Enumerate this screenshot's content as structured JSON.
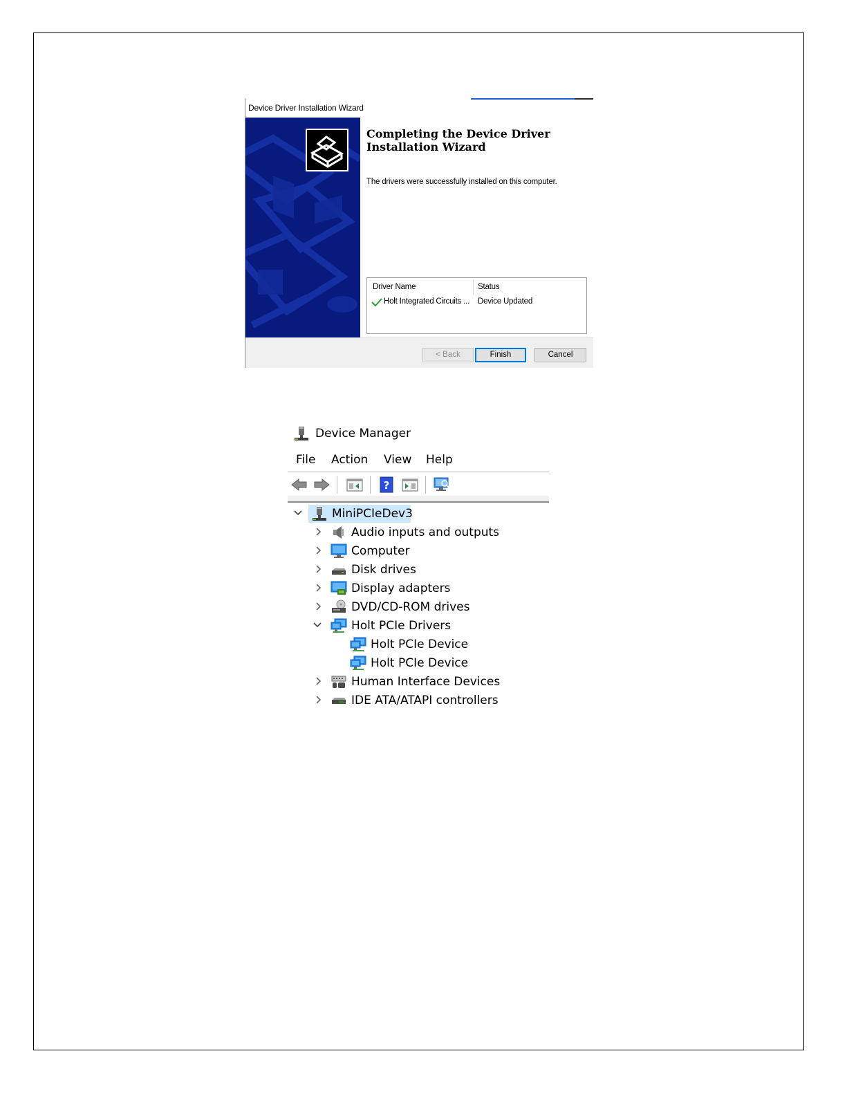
{
  "wizard": {
    "window_title": "Device Driver Installation Wizard",
    "heading_line1": "Completing the Device Driver",
    "heading_line2": "Installation Wizard",
    "message": "The drivers were successfully installed on this computer.",
    "table": {
      "columns": [
        "Driver Name",
        "Status"
      ],
      "rows": [
        {
          "name": "Holt Integrated Circuits ...",
          "status": "Device Updated",
          "icon": "check-icon"
        }
      ]
    },
    "buttons": {
      "back": "< Back",
      "finish": "Finish",
      "cancel": "Cancel"
    },
    "colors": {
      "banner": "#0a1e8c",
      "banner_dark": "#050f55",
      "check": "#2e9a3a"
    }
  },
  "device_manager": {
    "title": "Device Manager",
    "menu": [
      "File",
      "Action",
      "View",
      "Help"
    ],
    "toolbar": [
      "back-arrow-icon",
      "forward-arrow-icon",
      "properties-icon",
      "help-icon",
      "update-driver-icon",
      "scan-hardware-icon"
    ],
    "tree": {
      "root": "MiniPCIeDev3",
      "categories": [
        {
          "label": "Audio inputs and outputs",
          "icon": "speaker-icon",
          "expanded": false
        },
        {
          "label": "Computer",
          "icon": "monitor-icon",
          "expanded": false
        },
        {
          "label": "Disk drives",
          "icon": "disk-drive-icon",
          "expanded": false
        },
        {
          "label": "Display adapters",
          "icon": "display-adapter-icon",
          "expanded": false
        },
        {
          "label": "DVD/CD-ROM drives",
          "icon": "dvd-drive-icon",
          "expanded": false
        },
        {
          "label": "Holt PCIe Drivers",
          "icon": "network-adapter-icon",
          "expanded": true,
          "children": [
            "Holt PCIe Device",
            "Holt PCIe Device"
          ]
        },
        {
          "label": "Human Interface Devices",
          "icon": "hid-icon",
          "expanded": false
        },
        {
          "label": "IDE ATA/ATAPI controllers",
          "icon": "ide-controller-icon",
          "expanded": false
        }
      ]
    },
    "colors": {
      "selection": "#cce8ff",
      "accent": "#1e88e5"
    }
  }
}
